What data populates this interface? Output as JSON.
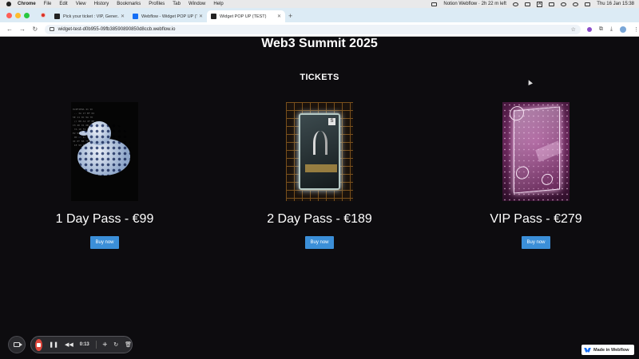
{
  "menubar": {
    "app": "Chrome",
    "items": [
      "File",
      "Edit",
      "View",
      "History",
      "Bookmarks",
      "Profiles",
      "Tab",
      "Window",
      "Help"
    ],
    "status_text": "Notion Webflow · 2h 22 m left",
    "clock": "Thu 16 Jan  15:38"
  },
  "tabs": [
    {
      "label": "Pick your ticket : VIP, Gener..."
    },
    {
      "label": "Webflow - Widget POP UP (Tr..."
    },
    {
      "label": "Widget POP UP (TEST)"
    }
  ],
  "address_bar": {
    "url": "widget-test-d0b955-09fb38590890850d8ccb.webflow.io"
  },
  "page": {
    "event_title": "Web3 Summit 2025",
    "section_title": "TICKETS",
    "tickets": [
      {
        "name": "1 Day Pass - €99",
        "button": "Buy now"
      },
      {
        "name": "2 Day Pass - €189",
        "button": "Buy now"
      },
      {
        "name": "VIP Pass - €279",
        "button": "Buy now"
      }
    ]
  },
  "recorder": {
    "time": "0:13"
  },
  "badge": {
    "label": "Made in Webflow"
  },
  "colors": {
    "page_background": "#0d0c0f",
    "button": "#3b8fd8",
    "stop": "#e0463c",
    "webflow_blue": "#146ef5"
  }
}
